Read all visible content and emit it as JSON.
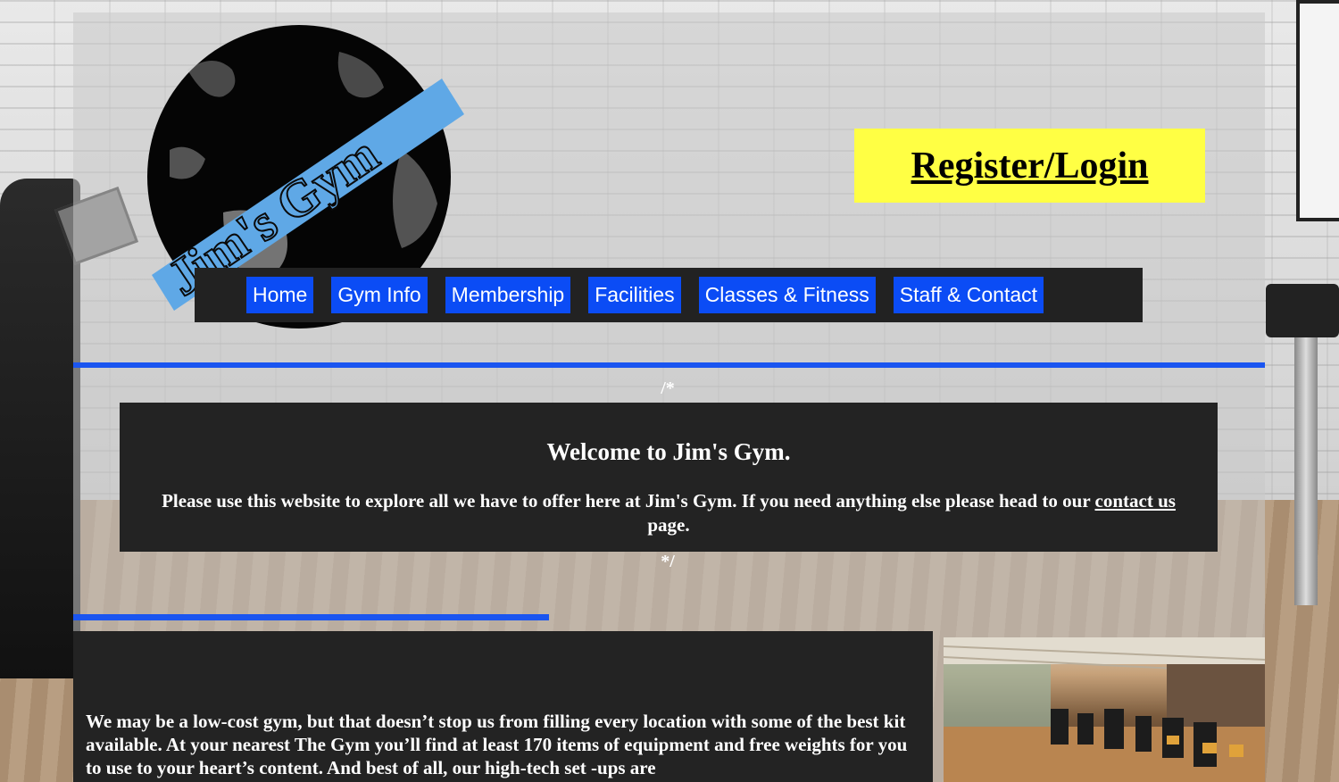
{
  "logo": {
    "text": "Jim's Gym"
  },
  "header": {
    "register_label": "Register/Login"
  },
  "nav": {
    "items": [
      {
        "label": "Home"
      },
      {
        "label": "Gym Info"
      },
      {
        "label": "Membership"
      },
      {
        "label": "Facilities"
      },
      {
        "label": "Classes & Fitness"
      },
      {
        "label": "Staff & Contact"
      }
    ]
  },
  "comment": {
    "open": "/*",
    "close": "*/"
  },
  "welcome": {
    "title": "Welcome to Jim's Gym.",
    "text_before_link": "Please use this website to explore all we have to offer here at Jim's Gym. If you need anything else please head to our ",
    "link_text": "contact us",
    "text_after_link": " page."
  },
  "info": {
    "text": "We may be a low-cost gym, but that doesn’t stop us from filling every location with some of the best kit available. At your nearest The Gym you’ll find at least 170 items of equipment and free weights for you to use to your heart’s content. And best of all, our high-tech set -ups are"
  },
  "colors": {
    "nav_bg": "#222222",
    "nav_item": "#0b4cf5",
    "register_bg": "#ffff44",
    "rule": "#1a55f0",
    "dark_box": "#232323"
  }
}
